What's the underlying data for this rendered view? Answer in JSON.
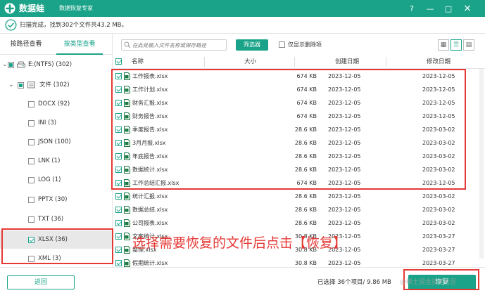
{
  "app": {
    "name": "数据蛙",
    "subtitle": "数据恢复专家"
  },
  "window_controls": {
    "help": "?",
    "minimize": "—",
    "maximize": "□",
    "close": "×"
  },
  "status": {
    "text": "扫描完成，找到302个文件共43.2 MB。"
  },
  "tabs": [
    {
      "label": "按路径查看"
    },
    {
      "label": "按类型查看"
    }
  ],
  "tree": {
    "drive": {
      "label": "E:(NTFS) (302)"
    },
    "folder": {
      "label": "文件 (302)"
    },
    "types": [
      {
        "label": "DOCX (92)",
        "checked": false
      },
      {
        "label": "INI (3)",
        "checked": false
      },
      {
        "label": "JSON (100)",
        "checked": false
      },
      {
        "label": "LNK (1)",
        "checked": false
      },
      {
        "label": "LOG (1)",
        "checked": false
      },
      {
        "label": "PPTX (30)",
        "checked": false
      },
      {
        "label": "TXT (36)",
        "checked": false
      },
      {
        "label": "XLSX (36)",
        "checked": true
      },
      {
        "label": "XML (3)",
        "checked": false
      }
    ]
  },
  "toolbar": {
    "search_placeholder": "在此处输入文件名称或保存路径",
    "filter_label": "筛选器",
    "only_deleted_label": "仅显示删除项"
  },
  "table": {
    "headers": {
      "name": "名称",
      "size": "大小",
      "created": "创建日期",
      "modified": "修改日期"
    },
    "rows": [
      {
        "name": "工作报表.xlsx",
        "size": "674 KB",
        "created": "2023-12-05",
        "modified": "2023-12-05"
      },
      {
        "name": "工作计划.xlsx",
        "size": "674 KB",
        "created": "2023-12-05",
        "modified": "2023-12-05"
      },
      {
        "name": "财务汇报.xlsx",
        "size": "674 KB",
        "created": "2023-12-05",
        "modified": "2023-12-05"
      },
      {
        "name": "财务报告.xlsx",
        "size": "674 KB",
        "created": "2023-12-05",
        "modified": "2023-12-05"
      },
      {
        "name": "季度报告.xlsx",
        "size": "28.6 KB",
        "created": "2023-12-05",
        "modified": "2023-03-02"
      },
      {
        "name": "3月月报.xlsx",
        "size": "28.6 KB",
        "created": "2023-12-05",
        "modified": "2023-03-02"
      },
      {
        "name": "年底报告.xlsx",
        "size": "28.6 KB",
        "created": "2023-12-05",
        "modified": "2023-03-02"
      },
      {
        "name": "数据统计.xlsx",
        "size": "28.6 KB",
        "created": "2023-12-05",
        "modified": "2023-03-02"
      },
      {
        "name": "工作总结汇报.xlsx",
        "size": "674 KB",
        "created": "2023-12-05",
        "modified": "2023-12-05"
      },
      {
        "name": "统计汇报.xlsx",
        "size": "28.6 KB",
        "created": "2023-12-05",
        "modified": "2023-03-02"
      },
      {
        "name": "数据总结.xlsx",
        "size": "28.6 KB",
        "created": "2023-12-05",
        "modified": "2023-03-02"
      },
      {
        "name": "公司报表.xlsx",
        "size": "28.6 KB",
        "created": "2023-12-05",
        "modified": "2023-03-02"
      },
      {
        "name": "文案统计.xlsx",
        "size": "30.8 KB",
        "created": "2023-12-05",
        "modified": "2023-03-27"
      },
      {
        "name": "整理.xlsx",
        "size": "30.8 KB",
        "created": "2023-12-05",
        "modified": "2023-03-27"
      },
      {
        "name": "假期统计.xlsx",
        "size": "30.8 KB",
        "created": "2023-12-05",
        "modified": "2023-03-27"
      }
    ]
  },
  "bottom": {
    "back_label": "返回",
    "selection_info": "已选择 36个项目/ 9.86 MB",
    "recover_label": "恢复"
  },
  "annotation": {
    "text": "选择需要恢复的文件后点击【恢复】",
    "color": "#e53935"
  },
  "watermark": "@稀土掘金技术社区",
  "colors": {
    "brand": "#1aa388",
    "annotation": "#e53935"
  }
}
